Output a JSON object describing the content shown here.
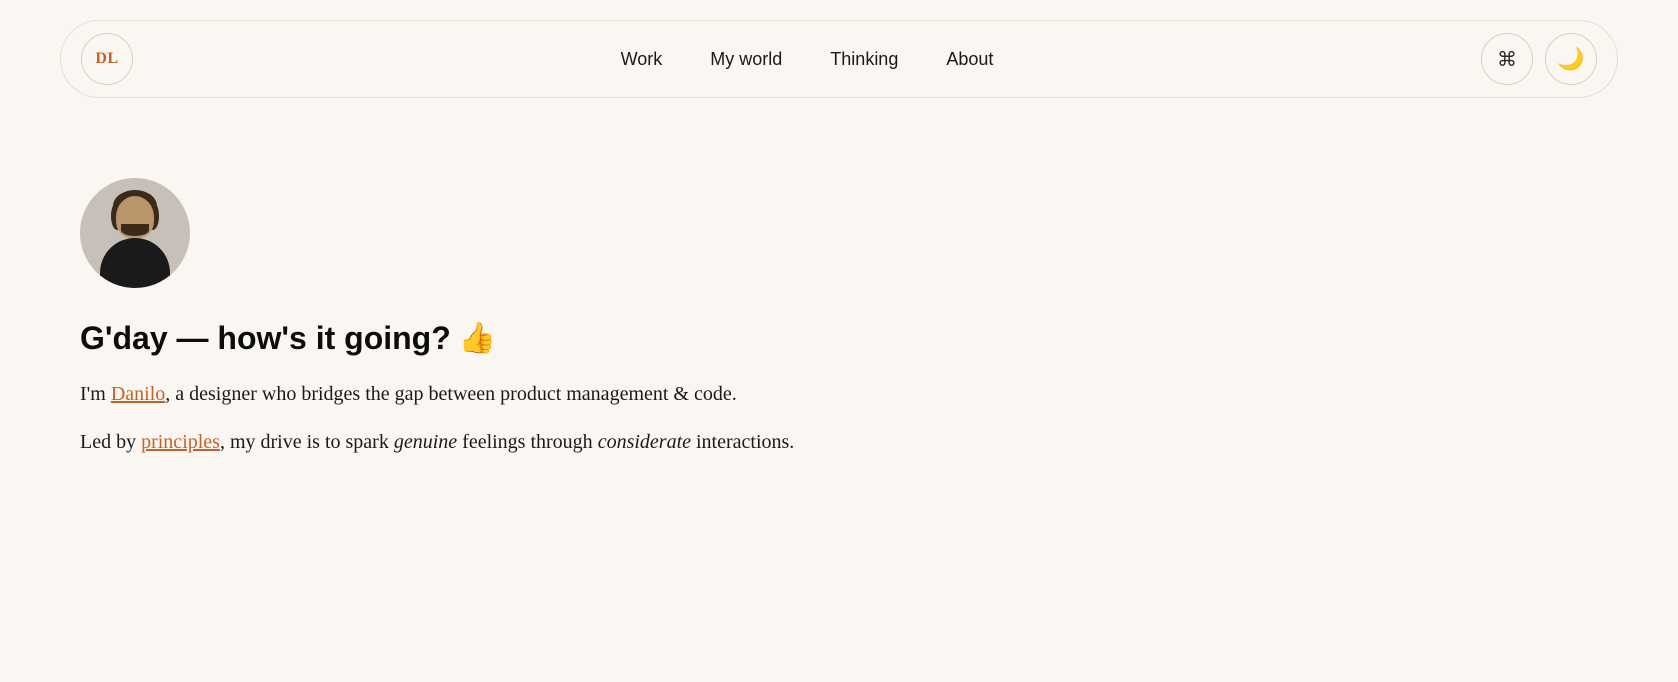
{
  "brand": {
    "logo_text": "DL"
  },
  "nav": {
    "links": [
      {
        "label": "Work",
        "id": "work"
      },
      {
        "label": "My world",
        "id": "my-world"
      },
      {
        "label": "Thinking",
        "id": "thinking"
      },
      {
        "label": "About",
        "id": "about"
      }
    ],
    "command_icon": "⌘",
    "dark_mode_icon": "🌙"
  },
  "hero": {
    "greeting": "G'day — how's it going?",
    "greeting_emoji": "👍",
    "intro_line1_before": "I'm ",
    "intro_link1": "Danilo",
    "intro_line1_after": ", a designer who bridges the gap between product management & code.",
    "intro_line2_before": "Led by ",
    "intro_link2": "principles",
    "intro_line2_after": ", my drive is to spark ",
    "intro_italic1": "genuine",
    "intro_mid": " feelings through ",
    "intro_italic2": "considerate",
    "intro_end": " interactions."
  }
}
